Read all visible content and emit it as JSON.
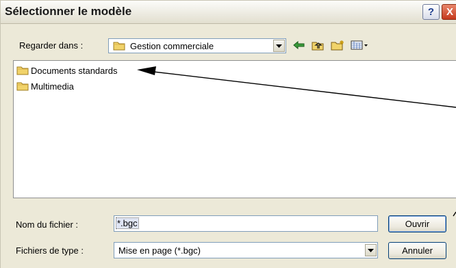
{
  "window": {
    "title": "Sélectionner le modèle",
    "help_glyph": "?",
    "close_glyph": "X"
  },
  "look_in": {
    "label": "Regarder dans :",
    "value": "Gestion commerciale"
  },
  "toolbar_icons": [
    "back-arrow-icon",
    "up-folder-icon",
    "new-folder-icon",
    "view-menu-icon"
  ],
  "files": [
    {
      "name": "Documents standards",
      "icon": "folder-icon"
    },
    {
      "name": "Multimedia",
      "icon": "folder-icon"
    }
  ],
  "filename": {
    "label": "Nom du fichier :",
    "value": "*.bgc"
  },
  "filetype": {
    "label": "Fichiers de type :",
    "value": "Mise en page (*.bgc)"
  },
  "buttons": {
    "open": "Ouvrir",
    "cancel": "Annuler"
  },
  "colors": {
    "dialog_bg": "#ece9d8",
    "annotation_arrow": "#000000",
    "folder": "#f1d36a"
  }
}
